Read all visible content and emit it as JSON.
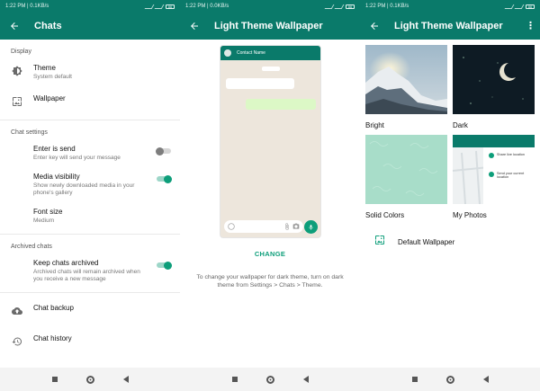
{
  "status": {
    "time_net": "1:22 PM | 0.1KB/s",
    "time_net_2": "1:22 PM | 0.0KB/s",
    "time_net_3": "1:22 PM | 0.1KB/s",
    "battery": "86"
  },
  "panel1": {
    "title": "Chats",
    "section_display": "Display",
    "theme_label": "Theme",
    "theme_value": "System default",
    "wallpaper_label": "Wallpaper",
    "section_chat_settings": "Chat settings",
    "enter_send_label": "Enter is send",
    "enter_send_desc": "Enter key will send your message",
    "enter_send_on": false,
    "media_vis_label": "Media visibility",
    "media_vis_desc": "Show newly downloaded media in your phone's gallery",
    "media_vis_on": true,
    "font_size_label": "Font size",
    "font_size_value": "Medium",
    "section_archived": "Archived chats",
    "keep_archived_label": "Keep chats archived",
    "keep_archived_desc": "Archived chats will remain archived when you receive a new message",
    "keep_archived_on": true,
    "backup_label": "Chat backup",
    "history_label": "Chat history"
  },
  "panel2": {
    "title": "Light Theme Wallpaper",
    "preview_contact": "Contact Name",
    "change_label": "CHANGE",
    "help_text": "To change your wallpaper for dark theme, turn on dark theme from Settings > Chats > Theme."
  },
  "panel3": {
    "title": "Light Theme Wallpaper",
    "tiles": [
      "Bright",
      "Dark",
      "Solid Colors",
      "My Photos"
    ],
    "myphotos_line1": "Share live location",
    "myphotos_line2": "Send your current location",
    "default_label": "Default Wallpaper"
  },
  "colors": {
    "primary": "#0a7a6a",
    "accent": "#0d9e7a"
  }
}
